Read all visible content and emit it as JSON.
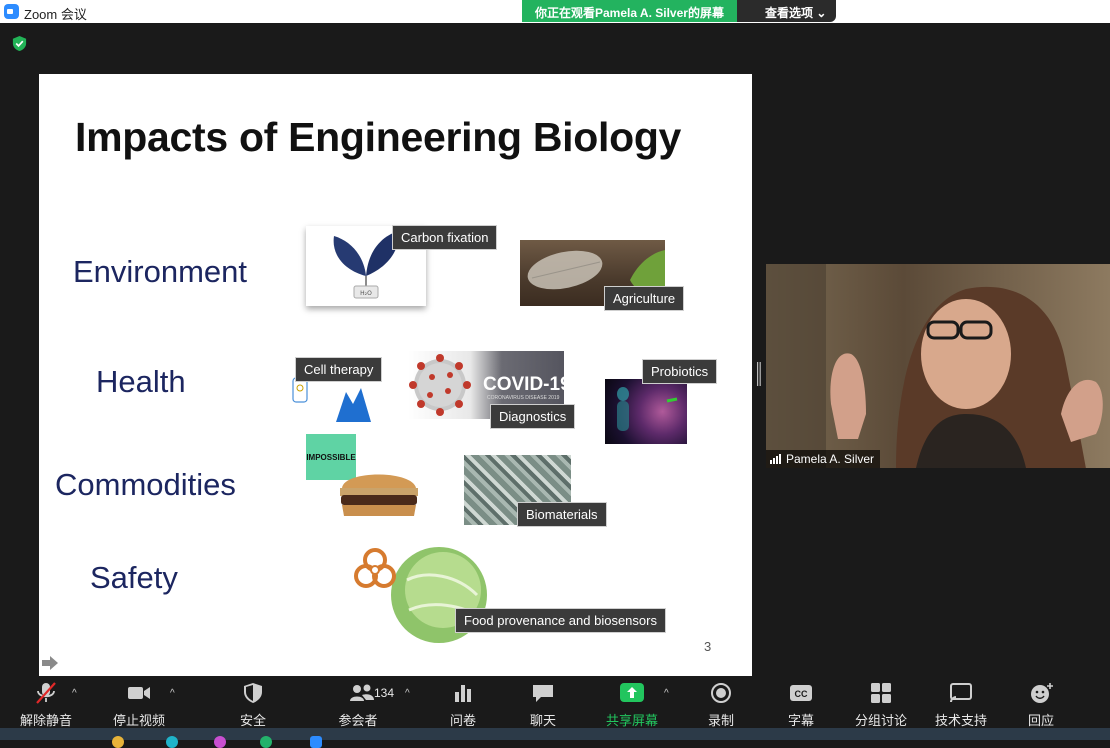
{
  "window": {
    "app_title": "Zoom 会议",
    "viewing_banner": "你正在观看Pamela A. Silver的屏幕",
    "view_options": "查看选项"
  },
  "slide": {
    "title": "Impacts of Engineering Biology",
    "categories": [
      "Environment",
      "Health",
      "Commodities",
      "Safety"
    ],
    "labels": {
      "carbon_fixation": "Carbon fixation",
      "agriculture": "Agriculture",
      "cell_therapy": "Cell therapy",
      "diagnostics": "Diagnostics",
      "probiotics": "Probiotics",
      "biomaterials": "Biomaterials",
      "food_provenance": "Food provenance and biosensors"
    },
    "image_text": {
      "covid": "COVID-19",
      "covid_sub": "CORONAVIRUS DISEASE 2019",
      "impossible": "IMPOSSIBLE",
      "h2o": "H₂O"
    },
    "page_number": "3"
  },
  "video": {
    "participant_name": "Pamela A. Silver"
  },
  "toolbar": {
    "unmute": "解除静音",
    "stop_video": "停止视频",
    "security": "安全",
    "participants": "参会者",
    "participants_count": "134",
    "polls": "问卷",
    "chat": "聊天",
    "share_screen": "共享屏幕",
    "record": "录制",
    "captions": "字幕",
    "breakout": "分组讨论",
    "support": "技术支持",
    "reactions": "回应",
    "cc": "CC"
  },
  "colors": {
    "green_banner": "#23b35f",
    "slide_category": "#1c2660",
    "share_green": "#22c55e",
    "mute_red": "#e02828"
  }
}
